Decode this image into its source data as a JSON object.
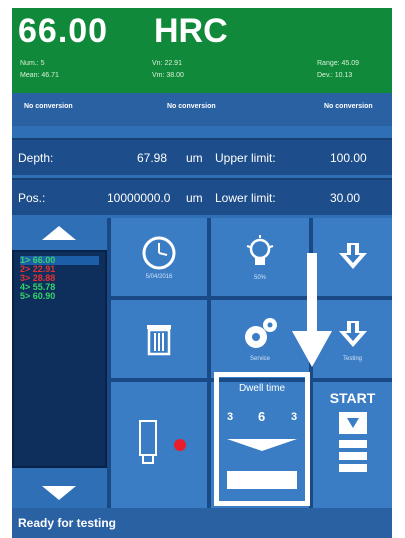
{
  "header": {
    "value": "66.00",
    "unit": "HRC",
    "stats": {
      "num_label": "Num.: 5",
      "mean_label": "Mean: 46.71",
      "vn_label": "Vn: 22.91",
      "vm_label": "Vm: 38.00",
      "range_label": "Range: 45.09",
      "dev_label": "Dev.: 10.13"
    }
  },
  "conversions": [
    "No conversion",
    "No conversion",
    "No conversion"
  ],
  "info": {
    "depth_label": "Depth:",
    "depth_value": "67.98",
    "depth_unit": "um",
    "upper_label": "Upper limit:",
    "upper_value": "100.00",
    "pos_label": "Pos.:",
    "pos_value": "10000000.0",
    "pos_unit": "um",
    "lower_label": "Lower limit:",
    "lower_value": "30.00"
  },
  "results": [
    {
      "text": "1> 66.00",
      "color": "#35d46a"
    },
    {
      "text": "2> 22.91",
      "color": "#e83030"
    },
    {
      "text": "3> 28.88",
      "color": "#e83030"
    },
    {
      "text": "4> 55.78",
      "color": "#35d46a"
    },
    {
      "text": "5> 60.90",
      "color": "#35d46a"
    }
  ],
  "buttons": {
    "clock_label": "5/04/2016",
    "light_label": "50%",
    "settings_label": "Service",
    "test_label": "Testing",
    "dwell_title": "Dwell time",
    "dwell_values": [
      "3",
      "6",
      "3"
    ],
    "start_label": "START"
  },
  "status": {
    "text": "Ready for testing"
  },
  "colors": {
    "header_green": "#11893a",
    "accent_blue": "#2f6fb5",
    "record_dot": "#e81f2a"
  }
}
